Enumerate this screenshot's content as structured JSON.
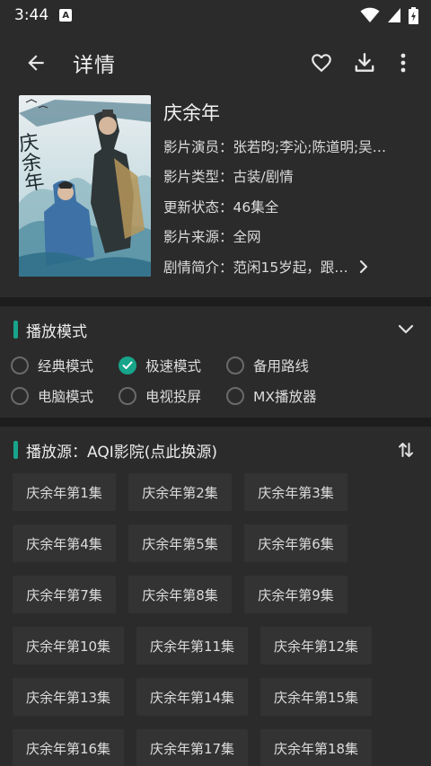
{
  "status_bar": {
    "time": "3:44",
    "notification_letter": "A"
  },
  "header": {
    "title": "详情"
  },
  "movie": {
    "title": "庆余年",
    "poster_title": "庆余年",
    "info": [
      {
        "label": "影片演员：",
        "value": "张若昀;李沁;陈道明;吴…"
      },
      {
        "label": "影片类型：",
        "value": "古装/剧情"
      },
      {
        "label": "更新状态：",
        "value": "46集全"
      },
      {
        "label": "影片来源：",
        "value": "全网"
      },
      {
        "label": "剧情简介：",
        "value": "范闲15岁起，跟…"
      }
    ]
  },
  "play_mode": {
    "title": "播放模式",
    "options": [
      {
        "label": "经典模式",
        "checked": false
      },
      {
        "label": "极速模式",
        "checked": true
      },
      {
        "label": "备用路线",
        "checked": false
      },
      {
        "label": "电脑模式",
        "checked": false
      },
      {
        "label": "电视投屏",
        "checked": false
      },
      {
        "label": "MX播放器",
        "checked": false
      }
    ]
  },
  "play_source": {
    "title": "播放源：AQI影院(点此换源)",
    "episodes": [
      "庆余年第1集",
      "庆余年第2集",
      "庆余年第3集",
      "庆余年第4集",
      "庆余年第5集",
      "庆余年第6集",
      "庆余年第7集",
      "庆余年第8集",
      "庆余年第9集",
      "庆余年第10集",
      "庆余年第11集",
      "庆余年第12集",
      "庆余年第13集",
      "庆余年第14集",
      "庆余年第15集",
      "庆余年第16集",
      "庆余年第17集",
      "庆余年第18集"
    ]
  },
  "colors": {
    "accent": "#17a48b",
    "background": "#2b2b2b",
    "divider": "#1d1d1d",
    "chip": "#333333"
  },
  "icons": {
    "back": "arrow-left-icon",
    "favorite": "heart-outline-icon",
    "download": "download-icon",
    "more": "more-vertical-icon",
    "expand": "chevron-down-icon",
    "sort": "sort-icon",
    "synopsis_more": "chevron-right-icon"
  }
}
